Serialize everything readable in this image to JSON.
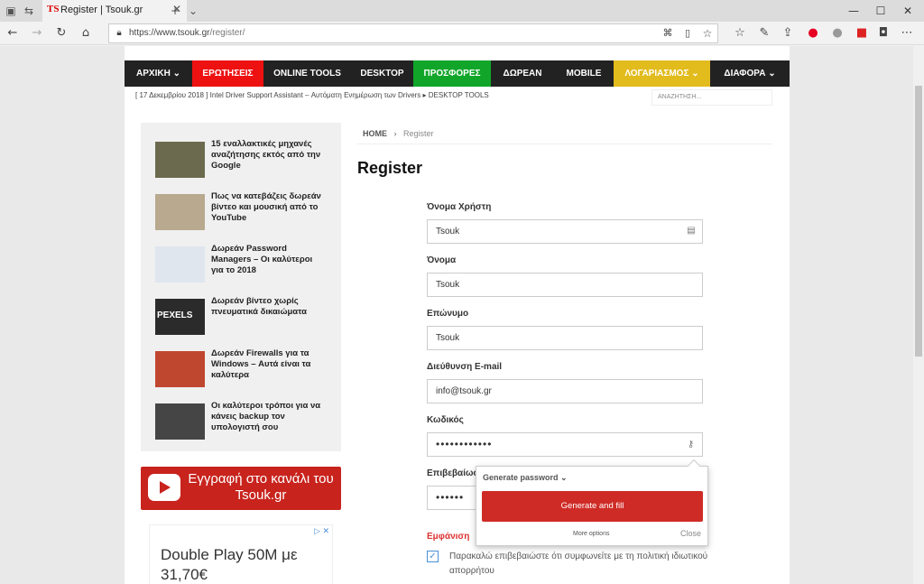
{
  "browser": {
    "tab_title": "Register | Tsouk.gr",
    "tab_logo": "TS",
    "url_host": "https://www.tsouk.gr",
    "url_path": "/register/"
  },
  "menu": [
    {
      "label": "ΑΡΧΙΚΗ ⌄",
      "bg": "#222222",
      "width": 75
    },
    {
      "label": "ΕΡΩΤΗΣΕΙΣ",
      "bg": "#ee1111",
      "width": 79
    },
    {
      "label": "ONLINE TOOLS",
      "bg": "#222222",
      "width": 97
    },
    {
      "label": "DESKTOP",
      "bg": "#222222",
      "width": 69
    },
    {
      "label": "ΠΡΟΣΦΟΡΕΣ",
      "bg": "#11a62a",
      "width": 86
    },
    {
      "label": "ΔΩΡΕΑΝ",
      "bg": "#222222",
      "width": 70
    },
    {
      "label": "MOBILE",
      "bg": "#222222",
      "width": 66
    },
    {
      "label": "ΛΟΓΑΡΙΑΣΜΟΣ ⌄",
      "bg": "#e2bb1d",
      "width": 107
    },
    {
      "label": "ΔΙΑΦΟΡΑ ⌄",
      "bg": "#222222",
      "width": 88
    }
  ],
  "ticker": "[ 17 Δεκεμβρίου 2018 ]  Intel Driver Support Assistant – Αυτόματη Ενημέρωση των Drivers  ▸ DESKTOP TOOLS",
  "search_placeholder": "ΑΝΑΖΗΤΗΣΗ...",
  "sidebar_posts": [
    {
      "title": "15 εναλλακτικές μηχανές αναζήτησης εκτός από την Google",
      "thumb": "#6b6a4e"
    },
    {
      "title": "Πως να κατεβάζεις δωρεάν βίντεο και μουσική από το YouTube",
      "thumb": "#b8a98f"
    },
    {
      "title": "Δωρεάν Password Managers – Οι καλύτεροι για το 2018",
      "thumb": "#dfe6ee"
    },
    {
      "title": "Δωρεάν βίντεο χωρίς πνευματικά δικαιώματα",
      "thumb": "#2b2b2b"
    },
    {
      "title": "Δωρεάν Firewalls για τα Windows – Αυτά είναι τα καλύτερα",
      "thumb": "#c0472f"
    },
    {
      "title": "Οι καλύτεροι τρόποι για να κάνεις backup τον υπολογιστή σου",
      "thumb": "#454545"
    }
  ],
  "thumb_texts": {
    "pexels": "PEXELS"
  },
  "youtube_banner": "Εγγραφή στο κανάλι του Tsouk.gr",
  "ad": {
    "text": "Double Play 50M με 31,70€",
    "close": "▷ ✕"
  },
  "breadcrumb": {
    "home": "HOME",
    "sep": "›",
    "current": "Register"
  },
  "register_title": "Register",
  "form": {
    "username_label": "Όνομα Χρήστη",
    "username_value": "Tsouk",
    "first_label": "Όνομα",
    "first_value": "Tsouk",
    "last_label": "Επώνυμο",
    "last_value": "Tsouk",
    "email_label": "Διεύθυνση E-mail",
    "email_value": "info@tsouk.gr",
    "password_label": "Κωδικός",
    "password_value": "••••••••••••",
    "confirm_label": "Επιβεβαίωση",
    "confirm_value": "••••••",
    "show_password": "Εμφάνιση",
    "agree_text": "Παρακαλώ επιβεβαιώστε ότι συμφωνείτε με τη πολιτική ιδιωτικού απορρήτου"
  },
  "password_popup": {
    "heading": "Generate password ⌄",
    "button": "Generate and fill",
    "more": "More options",
    "close": "Close"
  }
}
